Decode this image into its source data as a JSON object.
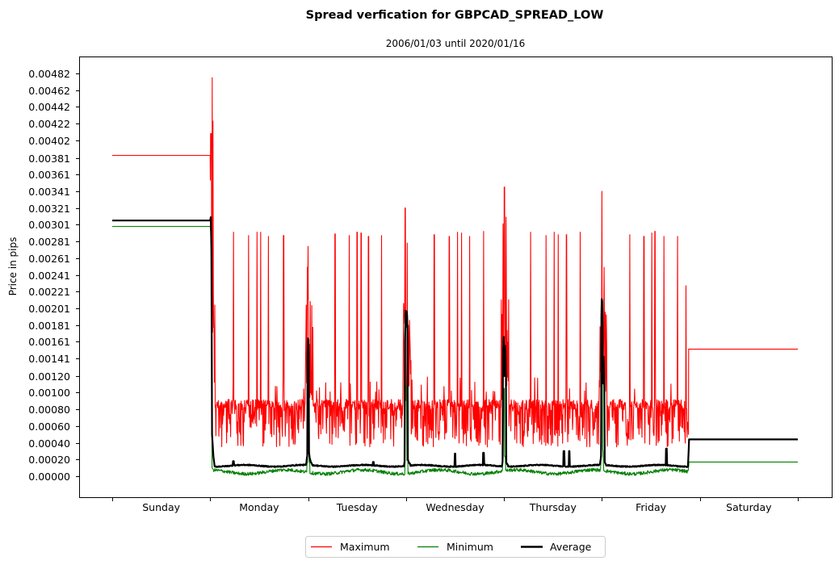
{
  "chart_data": {
    "type": "line",
    "title": "Spread verfication for GBPCAD_SPREAD_LOW",
    "subtitle": "2006/01/03 until 2020/01/16",
    "xlabel": "",
    "ylabel": "Price in pips",
    "x_unit": "hour of week (0 = Sunday 00:00)",
    "xlim": [
      0,
      168
    ],
    "ylim": [
      -0.0003,
      0.0052
    ],
    "grid": false,
    "legend_position": "bottom-center",
    "x_tick_labels": [
      "Sunday",
      "Monday",
      "Tuesday",
      "Wednesday",
      "Thursday",
      "Friday",
      "Saturday"
    ],
    "y_ticks": [
      0.0,
      0.0002,
      0.0004,
      0.0006,
      0.0008,
      0.001,
      0.0012,
      0.00141,
      0.00161,
      0.00181,
      0.00201,
      0.00221,
      0.00241,
      0.00261,
      0.00281,
      0.00301,
      0.00321,
      0.00341,
      0.00361,
      0.00381,
      0.00402,
      0.00422,
      0.00442,
      0.00462,
      0.00482
    ],
    "y_tick_labels": [
      "0.00000",
      "0.00020",
      "0.00040",
      "0.00060",
      "0.00080",
      "0.00100",
      "0.00120",
      "0.00141",
      "0.00161",
      "0.00181",
      "0.00201",
      "0.00221",
      "0.00241",
      "0.00261",
      "0.00281",
      "0.00301",
      "0.00321",
      "0.00341",
      "0.00361",
      "0.00381",
      "0.00402",
      "0.00422",
      "0.00442",
      "0.00462",
      "0.00482"
    ],
    "series": [
      {
        "name": "Maximum",
        "color": "#ff0000",
        "description": "Flat ~0.00384 on Sunday until market open (~Sun 24h), burst up to ~0.00477; weekdays oscillate 0.00035-0.00092 with isolated spikes to ~0.0029 and daily-rollover peaks; flat ~0.00152 on Saturday",
        "weekend_levels": {
          "sunday": 0.00384,
          "saturday": 0.00152
        },
        "weekday_band": [
          0.00035,
          0.00092
        ],
        "peaks": [
          {
            "x": 24.2,
            "y": 0.0041
          },
          {
            "x": 24.5,
            "y": 0.00477
          },
          {
            "x": 24.7,
            "y": 0.00425
          },
          {
            "x": 29.7,
            "y": 0.00292
          },
          {
            "x": 33.4,
            "y": 0.00288
          },
          {
            "x": 35.5,
            "y": 0.00292
          },
          {
            "x": 36.4,
            "y": 0.00292
          },
          {
            "x": 38.3,
            "y": 0.00287
          },
          {
            "x": 42.0,
            "y": 0.00288
          },
          {
            "x": 47.8,
            "y": 0.0025
          },
          {
            "x": 48.0,
            "y": 0.00275
          },
          {
            "x": 54.6,
            "y": 0.0029
          },
          {
            "x": 58.1,
            "y": 0.00288
          },
          {
            "x": 60.0,
            "y": 0.00292
          },
          {
            "x": 61.0,
            "y": 0.00291
          },
          {
            "x": 62.8,
            "y": 0.00287
          },
          {
            "x": 66.0,
            "y": 0.00288
          },
          {
            "x": 71.8,
            "y": 0.00321
          },
          {
            "x": 72.3,
            "y": 0.00279
          },
          {
            "x": 78.9,
            "y": 0.00289
          },
          {
            "x": 82.6,
            "y": 0.00287
          },
          {
            "x": 84.6,
            "y": 0.00292
          },
          {
            "x": 85.6,
            "y": 0.00291
          },
          {
            "x": 87.6,
            "y": 0.00287
          },
          {
            "x": 91.0,
            "y": 0.00293
          },
          {
            "x": 95.8,
            "y": 0.00302
          },
          {
            "x": 96.1,
            "y": 0.00346
          },
          {
            "x": 96.5,
            "y": 0.0031
          },
          {
            "x": 102.5,
            "y": 0.00292
          },
          {
            "x": 106.3,
            "y": 0.00288
          },
          {
            "x": 108.3,
            "y": 0.00292
          },
          {
            "x": 109.3,
            "y": 0.00289
          },
          {
            "x": 111.3,
            "y": 0.00289
          },
          {
            "x": 114.7,
            "y": 0.00292
          },
          {
            "x": 120.0,
            "y": 0.00341
          },
          {
            "x": 120.5,
            "y": 0.0025
          },
          {
            "x": 126.8,
            "y": 0.00289
          },
          {
            "x": 130.3,
            "y": 0.00287
          },
          {
            "x": 132.2,
            "y": 0.00291
          },
          {
            "x": 133.0,
            "y": 0.00293
          },
          {
            "x": 135.2,
            "y": 0.00287
          },
          {
            "x": 138.5,
            "y": 0.00287
          },
          {
            "x": 140.6,
            "y": 0.00228
          }
        ]
      },
      {
        "name": "Minimum",
        "color": "#008000",
        "description": "Flat ~0.00299 on Sunday, drops at market open to ~0.00003-0.0001 on weekdays with rollover bumps near ~0.0011; flat ~0.00017 on Saturday",
        "weekend_levels": {
          "sunday": 0.00299,
          "saturday": 0.00017
        },
        "weekday_band": [
          2e-05,
          0.0001
        ],
        "rollover_peaks": [
          {
            "x": 48.0,
            "y": 0.00112
          },
          {
            "x": 72.0,
            "y": 0.00108
          },
          {
            "x": 96.0,
            "y": 0.00105
          },
          {
            "x": 120.0,
            "y": 0.0011
          }
        ]
      },
      {
        "name": "Average",
        "color": "#000000",
        "description": "Flat ~0.00306 on Sunday, drops to ~0.00012-0.00015 on weekdays, rollover peaks ~0.0017-0.0022, flat ~0.00044 on Saturday",
        "weekend_levels": {
          "sunday": 0.00306,
          "saturday": 0.00044
        },
        "weekday_band": [
          0.00011,
          0.00016
        ],
        "rollover_peaks": [
          {
            "x": 48.0,
            "y": 0.00173
          },
          {
            "x": 71.9,
            "y": 0.00198
          },
          {
            "x": 72.2,
            "y": 0.00203
          },
          {
            "x": 95.9,
            "y": 0.00173
          },
          {
            "x": 96.3,
            "y": 0.00158
          },
          {
            "x": 120.0,
            "y": 0.0022
          },
          {
            "x": 120.4,
            "y": 0.00145
          }
        ],
        "small_bumps": [
          {
            "x": 29.7,
            "y": 0.00018
          },
          {
            "x": 64.0,
            "y": 0.00017
          },
          {
            "x": 84.0,
            "y": 0.00027
          },
          {
            "x": 91.0,
            "y": 0.00028
          },
          {
            "x": 110.7,
            "y": 0.0003
          },
          {
            "x": 112.0,
            "y": 0.0003
          },
          {
            "x": 135.8,
            "y": 0.00033
          }
        ]
      }
    ],
    "legend": [
      {
        "label": "Maximum",
        "color": "#ff0000"
      },
      {
        "label": "Minimum",
        "color": "#008000"
      },
      {
        "label": "Average",
        "color": "#000000"
      }
    ]
  }
}
